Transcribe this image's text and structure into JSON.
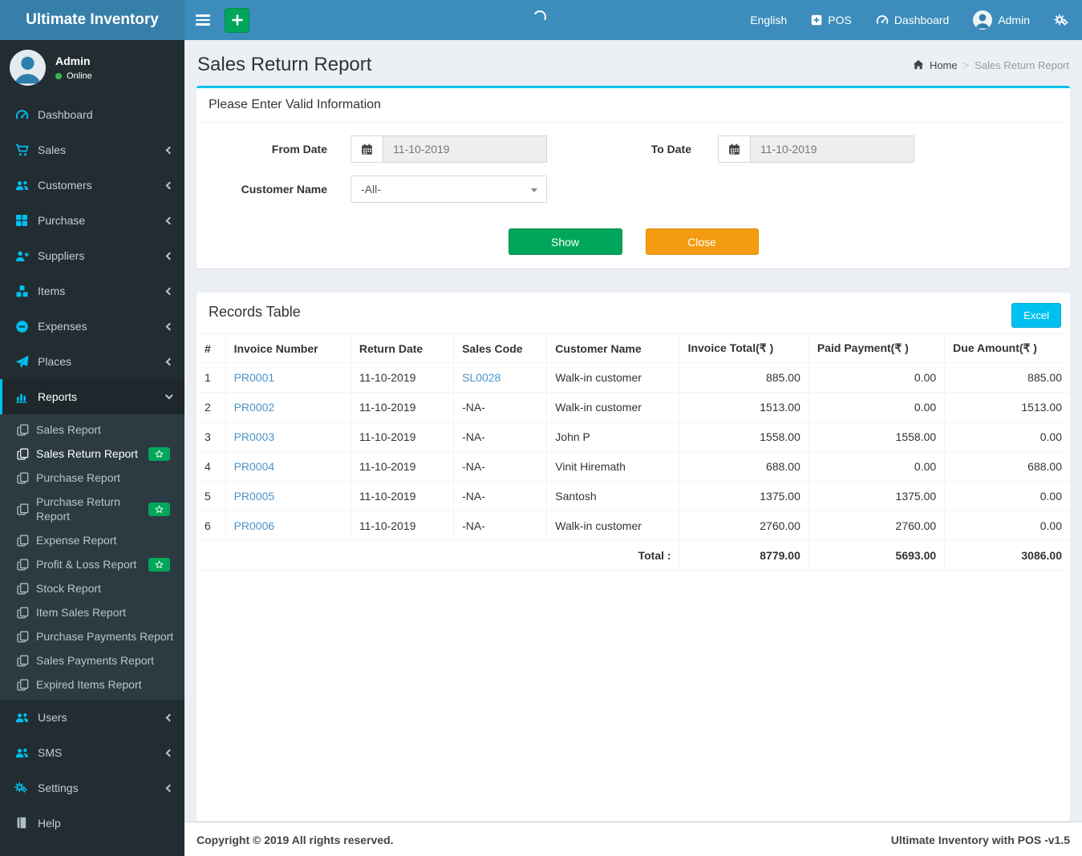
{
  "navbar": {
    "brand": "Ultimate Inventory",
    "language": "English",
    "pos": "POS",
    "dashboard": "Dashboard",
    "user": "Admin"
  },
  "sidebar": {
    "user": {
      "name": "Admin",
      "status": "Online"
    },
    "menu": [
      {
        "label": "Dashboard",
        "icon": "tachometer-icon"
      },
      {
        "label": "Sales",
        "icon": "cart-icon"
      },
      {
        "label": "Customers",
        "icon": "users-icon"
      },
      {
        "label": "Purchase",
        "icon": "grid-icon"
      },
      {
        "label": "Suppliers",
        "icon": "user-plus-icon"
      },
      {
        "label": "Items",
        "icon": "cubes-icon"
      },
      {
        "label": "Expenses",
        "icon": "minus-circle-icon"
      },
      {
        "label": "Places",
        "icon": "paper-plane-icon"
      },
      {
        "label": "Reports",
        "icon": "bar-chart-icon",
        "active": true,
        "expanded": true,
        "children": [
          {
            "label": "Sales Report"
          },
          {
            "label": "Sales Return Report",
            "active": true,
            "badge": "star"
          },
          {
            "label": "Purchase Report"
          },
          {
            "label": "Purchase Return Report",
            "badge": "star"
          },
          {
            "label": "Expense Report"
          },
          {
            "label": "Profit & Loss Report",
            "badge": "star"
          },
          {
            "label": "Stock Report"
          },
          {
            "label": "Item Sales Report"
          },
          {
            "label": "Purchase Payments Report"
          },
          {
            "label": "Sales Payments Report"
          },
          {
            "label": "Expired Items Report"
          }
        ]
      },
      {
        "label": "Users",
        "icon": "users-icon"
      },
      {
        "label": "SMS",
        "icon": "users-icon"
      },
      {
        "label": "Settings",
        "icon": "cogs-icon"
      },
      {
        "label": "Help",
        "icon": "book-icon"
      }
    ]
  },
  "page": {
    "title": "Sales Return Report",
    "breadcrumb": {
      "home": "Home",
      "current": "Sales Return Report"
    }
  },
  "filter": {
    "title": "Please Enter Valid Information",
    "from_label": "From Date",
    "from_value": "11-10-2019",
    "to_label": "To Date",
    "to_value": "11-10-2019",
    "customer_label": "Customer Name",
    "customer_value": "-All-",
    "show_label": "Show",
    "close_label": "Close"
  },
  "records": {
    "title": "Records Table",
    "excel_label": "Excel",
    "columns": [
      "#",
      "Invoice Number",
      "Return Date",
      "Sales Code",
      "Customer Name",
      "Invoice Total(₹ )",
      "Paid Payment(₹ )",
      "Due Amount(₹ )"
    ],
    "rows": [
      {
        "num": "1",
        "invoice": "PR0001",
        "return_date": "11-10-2019",
        "sales_code": "SL0028",
        "customer": "Walk-in customer",
        "invoice_total": "885.00",
        "paid": "0.00",
        "due": "885.00"
      },
      {
        "num": "2",
        "invoice": "PR0002",
        "return_date": "11-10-2019",
        "sales_code": "-NA-",
        "customer": "Walk-in customer",
        "invoice_total": "1513.00",
        "paid": "0.00",
        "due": "1513.00"
      },
      {
        "num": "3",
        "invoice": "PR0003",
        "return_date": "11-10-2019",
        "sales_code": "-NA-",
        "customer": "John P",
        "invoice_total": "1558.00",
        "paid": "1558.00",
        "due": "0.00"
      },
      {
        "num": "4",
        "invoice": "PR0004",
        "return_date": "11-10-2019",
        "sales_code": "-NA-",
        "customer": "Vinit Hiremath",
        "invoice_total": "688.00",
        "paid": "0.00",
        "due": "688.00"
      },
      {
        "num": "5",
        "invoice": "PR0005",
        "return_date": "11-10-2019",
        "sales_code": "-NA-",
        "customer": "Santosh",
        "invoice_total": "1375.00",
        "paid": "1375.00",
        "due": "0.00"
      },
      {
        "num": "6",
        "invoice": "PR0006",
        "return_date": "11-10-2019",
        "sales_code": "-NA-",
        "customer": "Walk-in customer",
        "invoice_total": "2760.00",
        "paid": "2760.00",
        "due": "0.00"
      }
    ],
    "total": {
      "label": "Total :",
      "invoice_total": "8779.00",
      "paid": "5693.00",
      "due": "3086.00"
    }
  },
  "footer": {
    "left": "Copyright © 2019 All rights reserved.",
    "right": "Ultimate Inventory with POS -v1.5"
  },
  "colors": {
    "navbar": "#3c8dbc",
    "logo_bg": "#367fa9",
    "sidebar_bg": "#222d32",
    "accent": "#00c0ef",
    "success": "#00a65a",
    "warning": "#f39c12",
    "content_bg": "#ecf0f5"
  }
}
